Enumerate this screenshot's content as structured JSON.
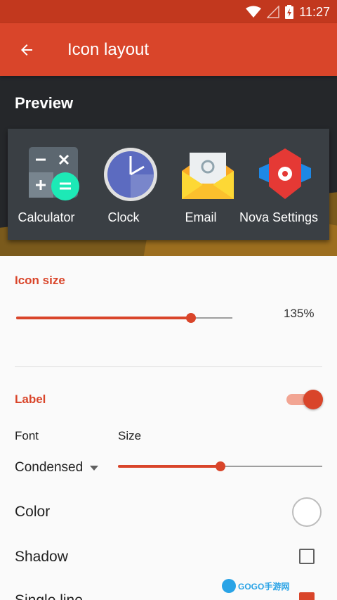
{
  "status_bar": {
    "time": "11:27",
    "icons": [
      "wifi-icon",
      "cell-signal-icon",
      "battery-charging-icon"
    ]
  },
  "app_bar": {
    "title": "Icon layout",
    "back_icon": "arrow-back-icon"
  },
  "preview": {
    "title": "Preview",
    "apps": [
      {
        "label": "Calculator",
        "icon": "calculator-icon"
      },
      {
        "label": "Clock",
        "icon": "clock-icon"
      },
      {
        "label": "Email",
        "icon": "email-icon"
      },
      {
        "label": "Nova Settings",
        "icon": "nova-settings-icon"
      }
    ]
  },
  "icon_size": {
    "heading": "Icon size",
    "value": "135%",
    "slider_fraction": 0.81
  },
  "label": {
    "heading": "Label",
    "toggle_on": true,
    "font_label": "Font",
    "size_label": "Size",
    "font_value": "Condensed",
    "size_slider_fraction": 0.5
  },
  "rows": {
    "color": "Color",
    "shadow": "Shadow",
    "single_line": "Single line"
  },
  "watermark": {
    "text": "GOGO手游网"
  },
  "colors": {
    "accent": "#d9452a",
    "status_bar": "#c2381e",
    "dock": "#3a3f44"
  }
}
